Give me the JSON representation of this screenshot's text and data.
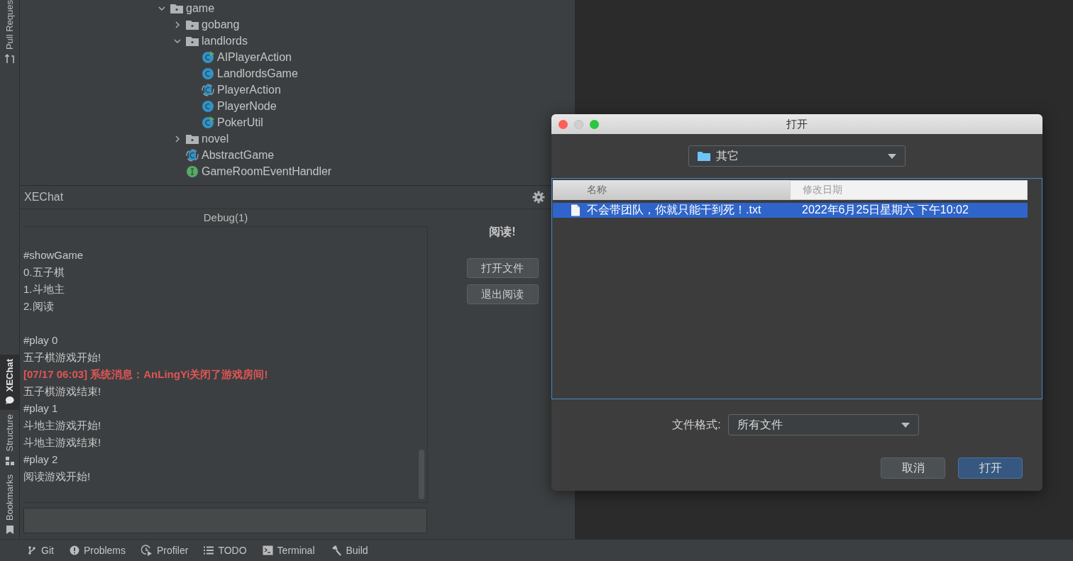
{
  "side_stripe": {
    "tabs": [
      {
        "label": "Pull Reques",
        "kind": "pull",
        "selected": false
      },
      {
        "label": "XEChat",
        "kind": "chat",
        "selected": true
      },
      {
        "label": "Structure",
        "kind": "structure",
        "selected": false
      },
      {
        "label": "Bookmarks",
        "kind": "bookmark",
        "selected": false
      }
    ]
  },
  "project_tree": {
    "items": [
      {
        "label": "game",
        "kind": "folder",
        "expanded": true,
        "children": [
          {
            "label": "gobang",
            "kind": "folder",
            "expanded": false
          },
          {
            "label": "landlords",
            "kind": "folder",
            "expanded": true,
            "children": [
              {
                "label": "AIPlayerAction",
                "kind": "class-run"
              },
              {
                "label": "LandlordsGame",
                "kind": "class"
              },
              {
                "label": "PlayerAction",
                "kind": "abstract"
              },
              {
                "label": "PlayerNode",
                "kind": "class"
              },
              {
                "label": "PokerUtil",
                "kind": "class-run"
              }
            ]
          },
          {
            "label": "novel",
            "kind": "folder",
            "expanded": false
          },
          {
            "label": "AbstractGame",
            "kind": "abstract"
          },
          {
            "label": "GameRoomEventHandler",
            "kind": "interface"
          }
        ]
      }
    ]
  },
  "chat_panel": {
    "title": "XEChat",
    "tab": "Debug(1)",
    "blocks": [
      {
        "lines": [
          {
            "text": "#showGame",
            "kind": "text"
          },
          {
            "text": "0.五子棋",
            "kind": "text"
          },
          {
            "text": "1.斗地主",
            "kind": "text"
          },
          {
            "text": "2.阅读",
            "kind": "text"
          }
        ]
      },
      {
        "lines": [
          {
            "text": "#play 0",
            "kind": "text"
          },
          {
            "text": "五子棋游戏开始!",
            "kind": "text"
          },
          {
            "text": "[07/17 06:03] 系统消息：AnLingYi关闭了游戏房间!",
            "kind": "system"
          },
          {
            "text": "五子棋游戏结束!",
            "kind": "text"
          },
          {
            "text": "#play 1",
            "kind": "text"
          },
          {
            "text": "斗地主游戏开始!",
            "kind": "text"
          },
          {
            "text": "斗地主游戏结束!",
            "kind": "text"
          },
          {
            "text": "#play 2",
            "kind": "text"
          },
          {
            "text": "阅读游戏开始!",
            "kind": "text"
          }
        ]
      }
    ],
    "side_title": "阅读!",
    "buttons": [
      "打开文件",
      "退出阅读"
    ]
  },
  "tool_bar": {
    "items": [
      {
        "label": "Git",
        "kind": "git"
      },
      {
        "label": "Problems",
        "kind": "problems"
      },
      {
        "label": "Profiler",
        "kind": "profiler"
      },
      {
        "label": "TODO",
        "kind": "todo"
      },
      {
        "label": "Terminal",
        "kind": "terminal"
      },
      {
        "label": "Build",
        "kind": "build"
      }
    ]
  },
  "dialog": {
    "title": "打开",
    "folder": "其它",
    "columns": [
      "名称",
      "修改日期"
    ],
    "rows": [
      {
        "name": "不会带团队，你就只能干到死！.txt",
        "modified": "2022年6月25日星期六 下午10:02",
        "selected": true
      }
    ],
    "format_label": "文件格式:",
    "format": "所有文件",
    "buttons": [
      {
        "label": "取消",
        "default": false
      },
      {
        "label": "打开",
        "default": true
      }
    ]
  }
}
